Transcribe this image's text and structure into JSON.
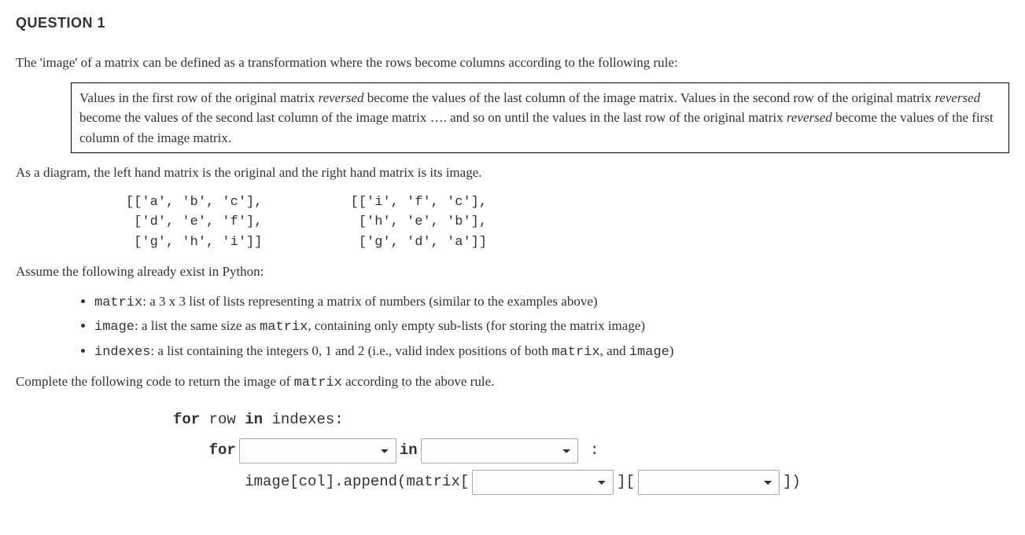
{
  "title": "QUESTION 1",
  "intro": "The 'image' of a matrix can be defined as a transformation where the rows become columns according to the following rule:",
  "rule": {
    "pre1": "Values in the first row of the original matrix ",
    "rev1": "reversed",
    "mid1": " become the values of the last column of the image matrix. Values in the second row of the original matrix ",
    "rev2": "reversed",
    "mid2": " become the values of the second last column of the image matrix …. and so on until the values in the last row of the original matrix ",
    "rev3": "reversed",
    "post": " become the values of the first column of the image matrix."
  },
  "diagramText": "As a diagram, the left hand matrix is the original and the right hand matrix is its image.",
  "matrixBlock": "[['a', 'b', 'c'],           [['i', 'f', 'c'],\n ['d', 'e', 'f'],            ['h', 'e', 'b'],\n ['g', 'h', 'i']]            ['g', 'd', 'a']]",
  "assumeText": "Assume the following already exist in Python:",
  "bullets": [
    {
      "code": "matrix",
      "tail": ": a 3 x 3 list of lists representing a matrix of numbers (similar to the examples above)"
    },
    {
      "code": "image",
      "tail": ": a list the same size as ",
      "code2": "matrix",
      "tail2": ", containing only empty sub-lists (for storing the matrix image)"
    },
    {
      "code": "indexes",
      "tail": ": a list containing the integers 0, 1 and 2 (i.e., valid index positions of both ",
      "code2": "matrix",
      "tail2": ", and ",
      "code3": "image",
      "tail3": ")"
    }
  ],
  "completeText": {
    "pre": "Complete the following code to return the image of ",
    "code": "matrix",
    "post": " according to the above rule."
  },
  "code": {
    "l1_for": "for ",
    "l1_row": "row ",
    "l1_in": "in ",
    "l1_idx": "indexes:",
    "l2_indent": "    ",
    "l2_for": "for",
    "l2_in": "in",
    "l2_colon": " :",
    "l3_indent": "        ",
    "l3_pre": "image[col].append(matrix[",
    "l3_mid": "][",
    "l3_end": "])"
  },
  "dropdowns": {
    "sel1": "",
    "sel2": "",
    "sel3": "",
    "sel4": ""
  }
}
